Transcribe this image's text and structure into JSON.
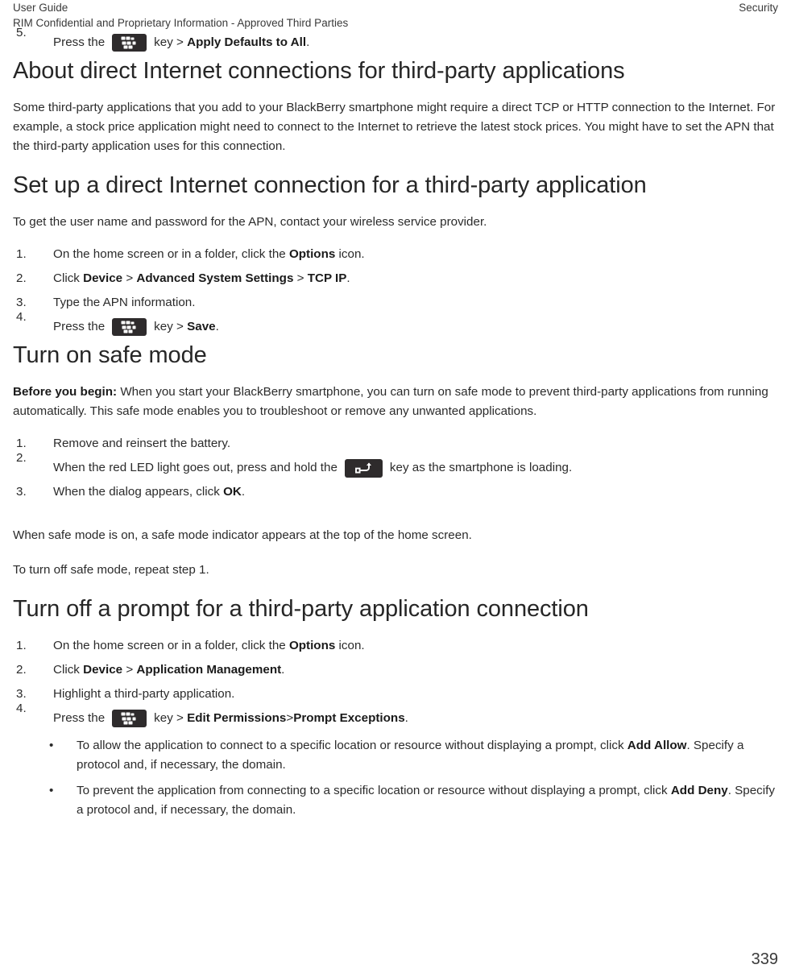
{
  "header": {
    "left_line1": "User Guide",
    "left_line2": "RIM Confidential and Proprietary Information - Approved Third Parties",
    "right": "Security"
  },
  "footer": {
    "page_number": "339"
  },
  "icons": {
    "menu_key": "blackberry-menu-key-icon",
    "escape_key": "escape-back-key-icon"
  },
  "content": {
    "step5_prev_section": {
      "num": "5.",
      "text_before": "Press the",
      "text_mid": "key >",
      "bold": "Apply Defaults to All",
      "text_after": "."
    },
    "section1": {
      "title": "About direct Internet connections for third-party applications",
      "paragraph": "Some third-party applications that you add to your BlackBerry smartphone might require a direct TCP or HTTP connection to the Internet. For example, a stock price application might need to connect to the Internet to retrieve the latest stock prices. You might have to set the APN that the third-party application uses for this connection."
    },
    "section2": {
      "title": "Set up a direct Internet connection for a third-party application",
      "intro": "To get the user name and password for the APN, contact your wireless service provider.",
      "steps": [
        {
          "num": "1.",
          "parts": [
            {
              "t": "text",
              "v": "On the home screen or in a folder, click the "
            },
            {
              "t": "bold",
              "v": "Options"
            },
            {
              "t": "text",
              "v": " icon."
            }
          ]
        },
        {
          "num": "2.",
          "parts": [
            {
              "t": "text",
              "v": "Click "
            },
            {
              "t": "bold",
              "v": "Device"
            },
            {
              "t": "text",
              "v": " > "
            },
            {
              "t": "bold",
              "v": "Advanced System Settings"
            },
            {
              "t": "text",
              "v": " > "
            },
            {
              "t": "bold",
              "v": "TCP IP"
            },
            {
              "t": "text",
              "v": "."
            }
          ]
        },
        {
          "num": "3.",
          "parts": [
            {
              "t": "text",
              "v": "Type the APN information."
            }
          ]
        },
        {
          "num": "4.",
          "key": "menu",
          "before": "Press the",
          "mid": "key >",
          "parts_after": [
            {
              "t": "bold",
              "v": "Save"
            },
            {
              "t": "text",
              "v": "."
            }
          ]
        }
      ]
    },
    "section3": {
      "title": "Turn on safe mode",
      "before_you_begin_label": "Before you begin:",
      "before_you_begin_text": " When you start your BlackBerry smartphone, you can turn on safe mode to prevent third-party applications from running automatically. This safe mode enables you to troubleshoot or remove any unwanted applications.",
      "steps": [
        {
          "num": "1.",
          "parts": [
            {
              "t": "text",
              "v": "Remove and reinsert the battery."
            }
          ]
        },
        {
          "num": "2.",
          "key": "esc",
          "before": "When the red LED light goes out, press and hold the",
          "mid": "key as the smartphone is loading.",
          "parts_after": []
        },
        {
          "num": "3.",
          "parts": [
            {
              "t": "text",
              "v": "When the dialog appears, click "
            },
            {
              "t": "bold",
              "v": "OK"
            },
            {
              "t": "text",
              "v": "."
            }
          ]
        }
      ],
      "after_para1": "When safe mode is on, a safe mode indicator appears at the top of the home screen.",
      "after_para2": "To turn off safe mode, repeat step 1."
    },
    "section4": {
      "title": "Turn off a prompt for a third-party application connection",
      "steps": [
        {
          "num": "1.",
          "parts": [
            {
              "t": "text",
              "v": "On the home screen or in a folder, click the "
            },
            {
              "t": "bold",
              "v": "Options"
            },
            {
              "t": "text",
              "v": " icon."
            }
          ]
        },
        {
          "num": "2.",
          "parts": [
            {
              "t": "text",
              "v": "Click "
            },
            {
              "t": "bold",
              "v": "Device"
            },
            {
              "t": "text",
              "v": " > "
            },
            {
              "t": "bold",
              "v": "Application Management"
            },
            {
              "t": "text",
              "v": "."
            }
          ]
        },
        {
          "num": "3.",
          "parts": [
            {
              "t": "text",
              "v": "Highlight a third-party application."
            }
          ]
        },
        {
          "num": "4.",
          "key": "menu",
          "before": "Press the",
          "mid": "key >",
          "parts_after": [
            {
              "t": "bold",
              "v": "Edit Permissions"
            },
            {
              "t": "text",
              "v": " > "
            },
            {
              "t": "bold",
              "v": "Prompt Exceptions"
            },
            {
              "t": "text",
              "v": "."
            }
          ]
        }
      ],
      "bullets": [
        {
          "marker": "•",
          "parts": [
            {
              "t": "text",
              "v": "To allow the application to connect to a specific location or resource without displaying a prompt, click "
            },
            {
              "t": "bold",
              "v": "Add Allow"
            },
            {
              "t": "text",
              "v": ". Specify a protocol and, if necessary, the domain."
            }
          ]
        },
        {
          "marker": "•",
          "parts": [
            {
              "t": "text",
              "v": "To prevent the application from connecting to a specific location or resource without displaying a prompt, click "
            },
            {
              "t": "bold",
              "v": "Add Deny"
            },
            {
              "t": "text",
              "v": ". Specify a protocol and, if necessary, the domain."
            }
          ]
        }
      ]
    }
  },
  "colors": {
    "text": "#2b2b2b",
    "heading": "#262626",
    "key_background": "#2e2b2c",
    "key_glyph": "#ffffff",
    "page_background": "#ffffff"
  }
}
